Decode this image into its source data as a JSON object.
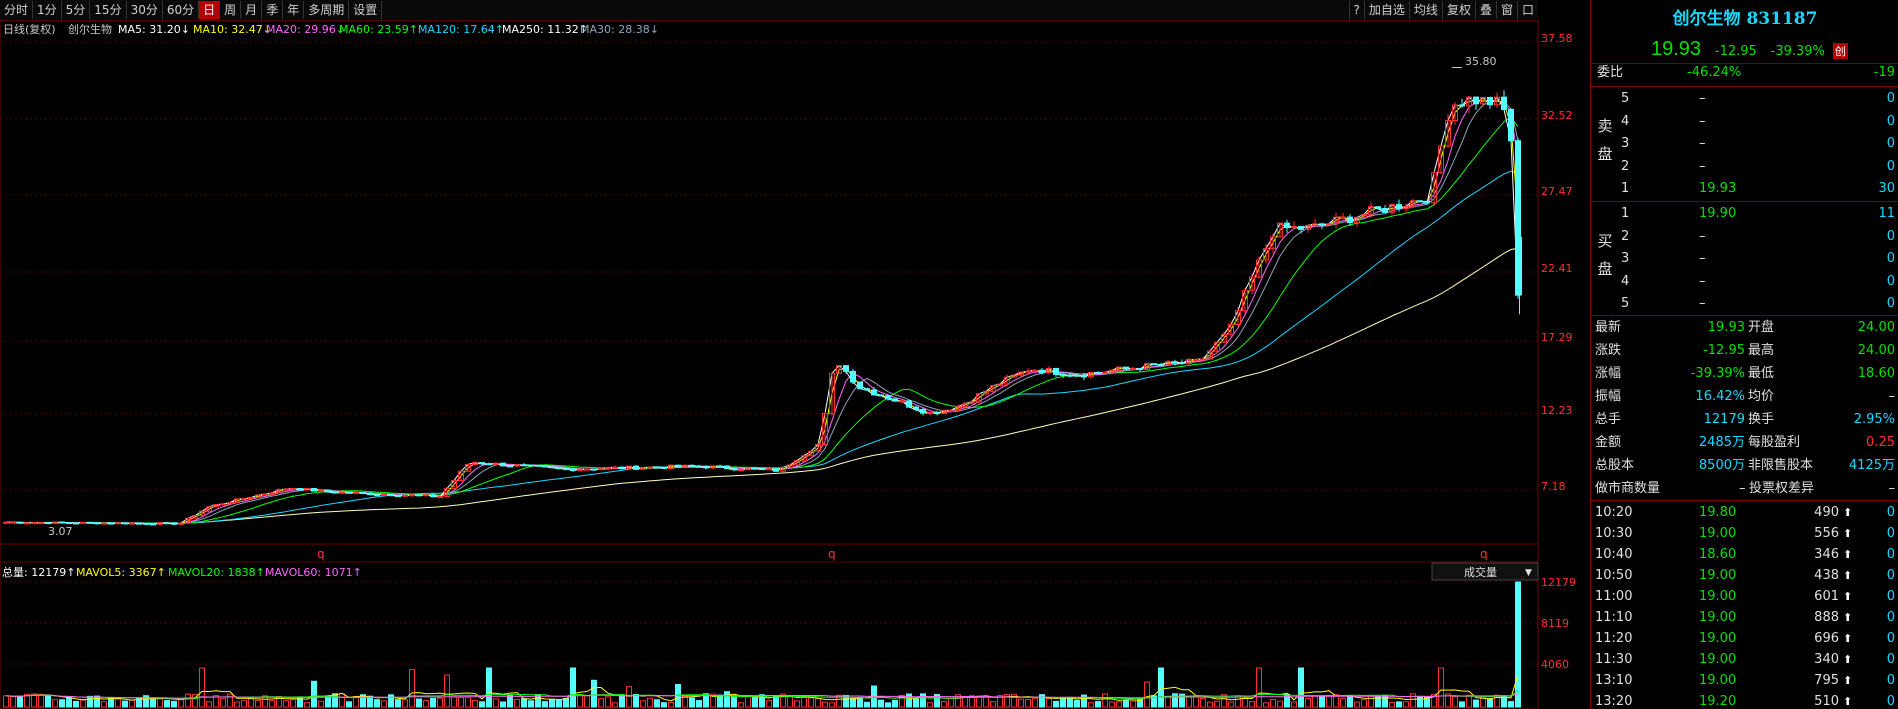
{
  "toolbar": {
    "period_tabs": [
      "分时",
      "1分",
      "5分",
      "15分",
      "30分",
      "60分",
      "日",
      "周",
      "月",
      "季",
      "年",
      "多周期",
      "设置"
    ],
    "active_tab": "日",
    "right_buttons": [
      "?",
      "加自选",
      "均线",
      "复权",
      "叠",
      "窗",
      "口"
    ]
  },
  "chart_header": {
    "label": "日线(复权)",
    "stock_name": "创尔生物",
    "ma_items": [
      {
        "text": "MA5: 31.20↓",
        "color": "#ffffff"
      },
      {
        "text": "MA10: 32.47↓",
        "color": "#ffff00"
      },
      {
        "text": "MA20: 29.96↓",
        "color": "#ff66ff"
      },
      {
        "text": "MA60: 23.59↑",
        "color": "#00ff00"
      },
      {
        "text": "MA120: 17.64↑",
        "color": "#19d7ff"
      },
      {
        "text": "MA250: 11.32↑",
        "color": "#ffffff"
      },
      {
        "text": "MA30: 28.38↓",
        "color": "#8aa6b8"
      }
    ]
  },
  "price_axis": [
    "37.58",
    "32.52",
    "27.47",
    "22.41",
    "17.29",
    "12.23",
    "7.18"
  ],
  "annotations": {
    "high_label": "35.80",
    "low_label": "3.07",
    "q_marks": [
      "q",
      "q",
      "q"
    ]
  },
  "volume_header": {
    "items": [
      {
        "text": "总量: 12179↑",
        "color": "#ffffff"
      },
      {
        "text": "MAVOL5: 3367↑",
        "color": "#ffff00"
      },
      {
        "text": "MAVOL20: 1838↑",
        "color": "#00ff00"
      },
      {
        "text": "MAVOL60: 1071↑",
        "color": "#ff66ff"
      }
    ],
    "selector": "成交量"
  },
  "volume_axis": [
    "12179",
    "8119",
    "4060"
  ],
  "chart_data": {
    "type": "candlestick",
    "note": "daily price chart with moving averages and volume",
    "price_ylim": [
      3.07,
      37.58
    ],
    "last_close": 19.93,
    "high": 35.8,
    "low": 3.07,
    "ma_last": {
      "MA5": 31.2,
      "MA10": 32.47,
      "MA20": 29.96,
      "MA30": 28.38,
      "MA60": 23.59,
      "MA120": 17.64,
      "MA250": 11.32
    },
    "volume_last": 12179,
    "mavol_last": {
      "MAVOL5": 3367,
      "MAVOL20": 1838,
      "MAVOL60": 1071
    }
  },
  "quote": {
    "title": "创尔生物 831187",
    "last": "19.93",
    "change": "-12.95",
    "change_pct": "-39.39%",
    "badge": "创",
    "weibi_label": "委比",
    "weibi_value": "-46.24%",
    "weibi_diff": "-19",
    "sell_label": [
      "卖",
      "盘"
    ],
    "buy_label": [
      "买",
      "盘"
    ],
    "sell": [
      {
        "level": "5",
        "price": "–",
        "vol": "0"
      },
      {
        "level": "4",
        "price": "–",
        "vol": "0"
      },
      {
        "level": "3",
        "price": "–",
        "vol": "0"
      },
      {
        "level": "2",
        "price": "–",
        "vol": "0"
      },
      {
        "level": "1",
        "price": "19.93",
        "vol": "30"
      }
    ],
    "buy": [
      {
        "level": "1",
        "price": "19.90",
        "vol": "11"
      },
      {
        "level": "2",
        "price": "–",
        "vol": "0"
      },
      {
        "level": "3",
        "price": "–",
        "vol": "0"
      },
      {
        "level": "4",
        "price": "–",
        "vol": "0"
      },
      {
        "level": "5",
        "price": "–",
        "vol": "0"
      }
    ],
    "stats": [
      {
        "l1": "最新",
        "v1": "19.93",
        "c1": "green",
        "l2": "开盘",
        "v2": "24.00",
        "c2": "green"
      },
      {
        "l1": "涨跌",
        "v1": "-12.95",
        "c1": "green",
        "l2": "最高",
        "v2": "24.00",
        "c2": "green"
      },
      {
        "l1": "涨幅",
        "v1": "-39.39%",
        "c1": "green",
        "l2": "最低",
        "v2": "18.60",
        "c2": "green"
      },
      {
        "l1": "振幅",
        "v1": "16.42%",
        "c1": "cyan",
        "l2": "均价",
        "v2": "–",
        "c2": "white"
      },
      {
        "l1": "总手",
        "v1": "12179",
        "c1": "cyan",
        "l2": "换手",
        "v2": "2.95%",
        "c2": "cyan"
      },
      {
        "l1": "金额",
        "v1": "2485万",
        "c1": "cyan",
        "l2": "每股盈利",
        "v2": "0.25",
        "c2": "red"
      },
      {
        "l1": "总股本",
        "v1": "8500万",
        "c1": "cyan",
        "l2": "非限售股本",
        "v2": "4125万",
        "c2": "cyan"
      }
    ],
    "extra": {
      "l1": "做市商数量",
      "v1": "–",
      "l2": "投票权差异",
      "v2": "–"
    },
    "ticks": [
      {
        "time": "10:20",
        "price": "19.80",
        "vol": "490",
        "side": "0"
      },
      {
        "time": "10:30",
        "price": "19.00",
        "vol": "556",
        "side": "0"
      },
      {
        "time": "10:40",
        "price": "18.60",
        "vol": "346",
        "side": "0"
      },
      {
        "time": "10:50",
        "price": "19.00",
        "vol": "438",
        "side": "0"
      },
      {
        "time": "11:00",
        "price": "19.00",
        "vol": "601",
        "side": "0"
      },
      {
        "time": "11:10",
        "price": "19.00",
        "vol": "888",
        "side": "0"
      },
      {
        "time": "11:20",
        "price": "19.00",
        "vol": "696",
        "side": "0"
      },
      {
        "time": "11:30",
        "price": "19.00",
        "vol": "340",
        "side": "0"
      },
      {
        "time": "13:10",
        "price": "19.00",
        "vol": "795",
        "side": "0"
      },
      {
        "time": "13:20",
        "price": "19.20",
        "vol": "510",
        "side": "0"
      }
    ]
  }
}
